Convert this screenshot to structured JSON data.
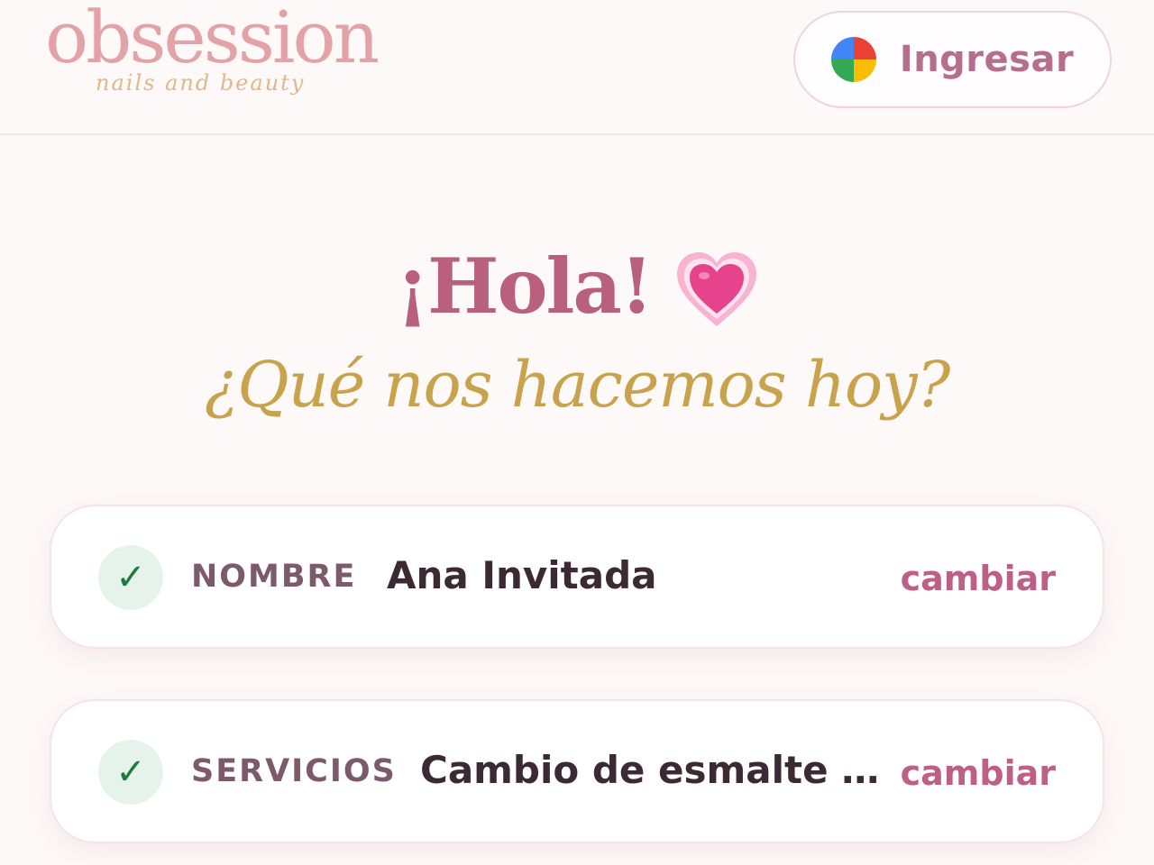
{
  "header": {
    "logo_text": "obsession",
    "logo_tagline": "nails and beauty",
    "login_label": "Ingresar",
    "login_icon": "google-g-icon"
  },
  "greeting": {
    "title": "¡Hola!",
    "emoji": "growing-heart-icon",
    "subtitle": "¿Qué nos hacemos hoy?"
  },
  "summary": [
    {
      "label": "NOMBRE",
      "value": "Ana Invitada",
      "action": "cambiar",
      "status_icon": "check-icon"
    },
    {
      "label": "SERVICIOS",
      "value": "Cambio de esmalte t…",
      "action": "cambiar",
      "status_icon": "check-icon"
    }
  ],
  "colors": {
    "brand_pink": "#b8607e",
    "brand_gold": "#c9a24c",
    "logo_pink": "#e3a3a6",
    "check_green": "#1f7a3e"
  }
}
